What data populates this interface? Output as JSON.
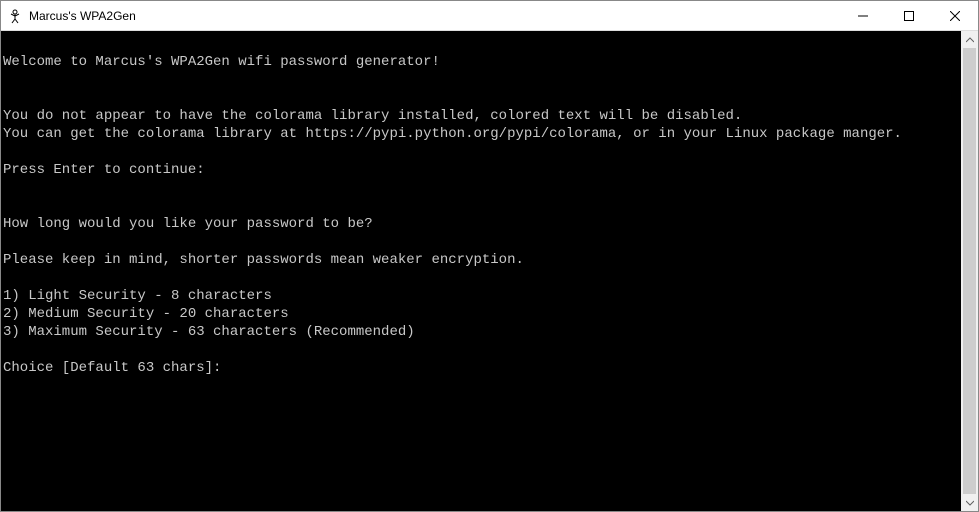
{
  "titlebar": {
    "title": "Marcus's WPA2Gen"
  },
  "console": {
    "lines": [
      "",
      "Welcome to Marcus's WPA2Gen wifi password generator!",
      "",
      "",
      "You do not appear to have the colorama library installed, colored text will be disabled.",
      "You can get the colorama library at https://pypi.python.org/pypi/colorama, or in your Linux package manger.",
      "",
      "Press Enter to continue:",
      "",
      "",
      "How long would you like your password to be?",
      "",
      "Please keep in mind, shorter passwords mean weaker encryption.",
      "",
      "1) Light Security - 8 characters",
      "2) Medium Security - 20 characters",
      "3) Maximum Security - 63 characters (Recommended)",
      "",
      "Choice [Default 63 chars]:"
    ]
  }
}
